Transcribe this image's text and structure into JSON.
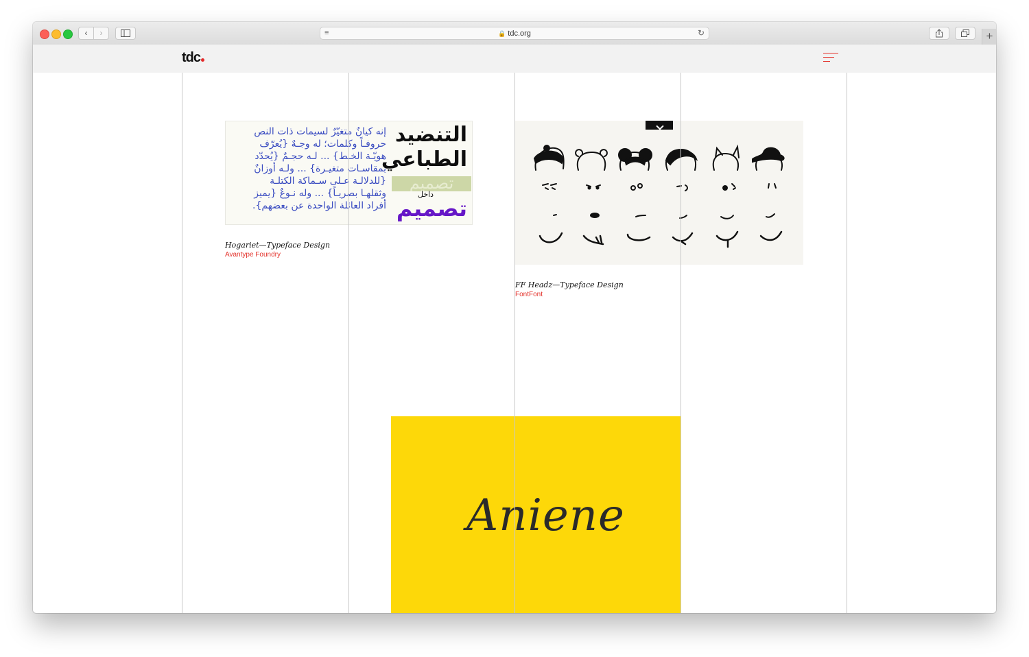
{
  "browser": {
    "url": "tdc.org"
  },
  "site": {
    "logo": "tdc",
    "accent": "#e3322b"
  },
  "cards": [
    {
      "title": "Hogariet—Typeface Design",
      "foundry": "Avantype Foundry",
      "image": {
        "body_lines": [
          "إنه كيانٌ متغيّرٌ لسيمات ذات النص",
          "حروفـاً وكلمات؛ له وجـهٌ {يُعرّف",
          "هويّـة الخـط} ... لـه حجـمٌ {يُحدّد",
          "بمقاسـات متغيـرة} ... ولـه أوزانٌ",
          "{للدلالـة عـلى سـماكة الكتلـة",
          "وثقلهـا بصريـاً} ... وله نـوعٌ {يميز",
          "أفراد العائلة الواحدة عن بعضهم}."
        ],
        "headline_1": "التنضيد",
        "headline_2": "الطباعي",
        "band_text": "تصميم",
        "small_word": "داخل",
        "purple_word": "تصميم"
      }
    },
    {
      "title": "FF Headz—Typeface Design",
      "foundry": "FontFont"
    },
    {
      "image": {
        "word": "Aniene",
        "background": "#fdd809"
      }
    }
  ]
}
